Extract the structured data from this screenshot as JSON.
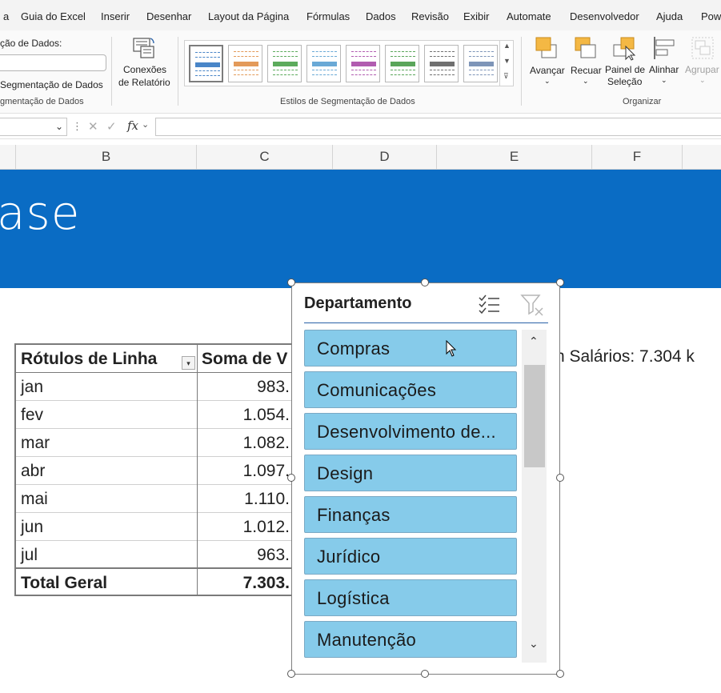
{
  "ribbon_tabs": [
    "Guia do Excel",
    "Inserir",
    "Desenhar",
    "Layout da Página",
    "Fórmulas",
    "Dados",
    "Revisão",
    "Exibir",
    "Automate",
    "Desenvolvedor",
    "Ajuda",
    "Pow"
  ],
  "tab_partial_left": "a",
  "slicer_group": {
    "caption_label": "ção de Dados:",
    "settings_label": "Segmentação de Dados",
    "group_label": "gmentação de Dados"
  },
  "report_connections": {
    "line1": "Conexões",
    "line2": "de Relatório"
  },
  "styles_group_label": "Estilos de Segmentação de Dados",
  "style_colors": [
    "#4a86c8",
    "#e39a5a",
    "#5cab5c",
    "#6aa9d6",
    "#b15cb0",
    "#5aa55a",
    "#707070",
    "#7e95b8"
  ],
  "arrange": {
    "bring_forward": "Avançar",
    "send_backward": "Recuar",
    "selection_pane_1": "Painel de",
    "selection_pane_2": "Seleção",
    "align": "Alinhar",
    "group": "Agrupar",
    "group_label": "Organizar"
  },
  "formula_bar": {
    "cancel": "✕",
    "enter": "✓",
    "fx": "fx",
    "value": ""
  },
  "columns": [
    "B",
    "C",
    "D",
    "E",
    "F"
  ],
  "banner_text": "ase",
  "pivot": {
    "header_rows": "Rótulos de Linha",
    "header_values": "Soma de V",
    "rows": [
      {
        "label": "jan",
        "value": "983."
      },
      {
        "label": "fev",
        "value": "1.054."
      },
      {
        "label": "mar",
        "value": "1.082."
      },
      {
        "label": "abr",
        "value": "1.097."
      },
      {
        "label": "mai",
        "value": "1.110."
      },
      {
        "label": "jun",
        "value": "1.012."
      },
      {
        "label": "jul",
        "value": "963."
      }
    ],
    "total_label": "Total Geral",
    "total_value": "7.303."
  },
  "salary_text": "n Salários: 7.304 k",
  "slicer": {
    "title": "Departamento",
    "items": [
      "Compras",
      "Comunicações",
      "Desenvolvimento de...",
      "Design",
      "Finanças",
      "Jurídico",
      "Logística",
      "Manutenção"
    ]
  }
}
